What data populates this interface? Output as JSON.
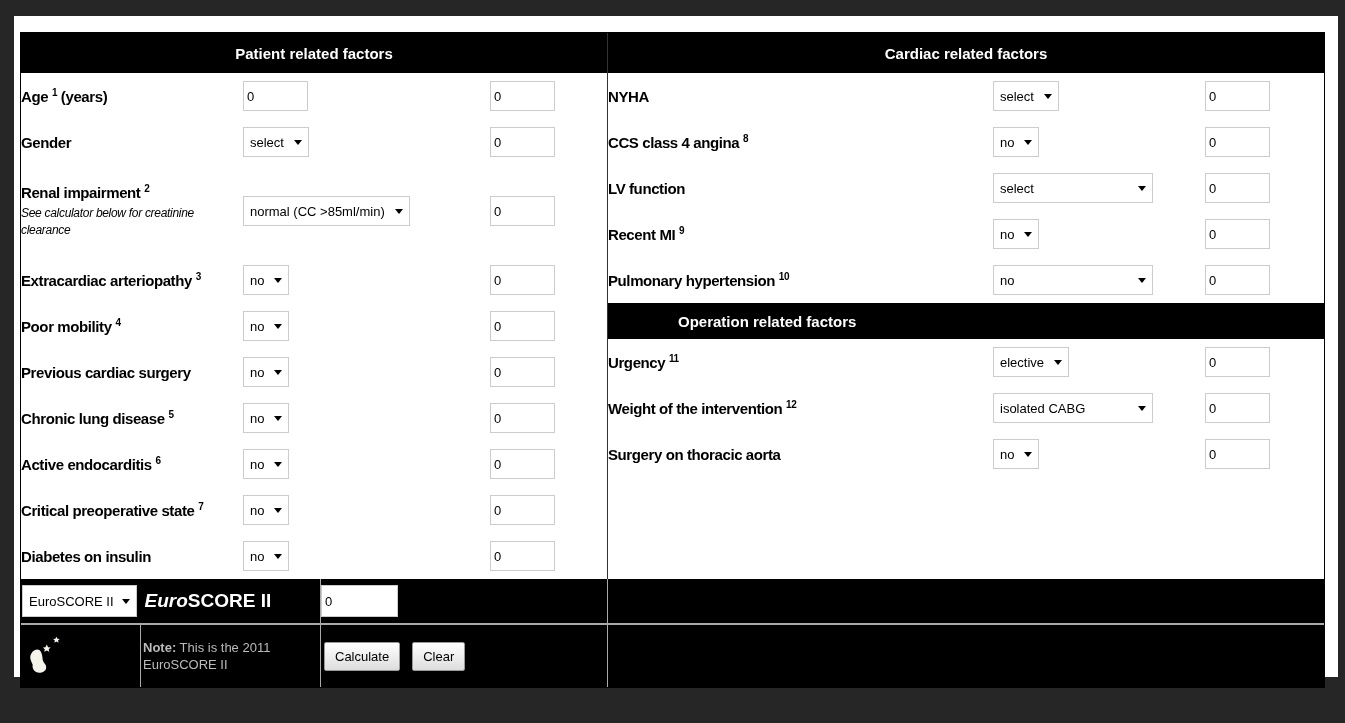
{
  "patient_factors": {
    "title": "Patient related factors",
    "rows": [
      {
        "label": "Age $^{1}$ (years)",
        "control": {
          "kind": "input",
          "value": "0"
        },
        "score": "0"
      },
      {
        "label": "Gender",
        "control": {
          "kind": "select",
          "value": "select"
        },
        "score": "0"
      },
      {
        "label": "Renal impairment $^{2}$",
        "note": "See calculator below for creatinine clearance",
        "control": {
          "kind": "select",
          "value": "normal (CC >85ml/min)"
        },
        "score": "0"
      },
      {
        "label": "Extracardiac arteriopathy $^{3}$",
        "control": {
          "kind": "select",
          "value": "no"
        },
        "score": "0"
      },
      {
        "label": "Poor mobility $^{4}$",
        "control": {
          "kind": "select",
          "value": "no"
        },
        "score": "0"
      },
      {
        "label": "Previous cardiac surgery",
        "control": {
          "kind": "select",
          "value": "no"
        },
        "score": "0"
      },
      {
        "label": "Chronic lung disease $^{5}$",
        "control": {
          "kind": "select",
          "value": "no"
        },
        "score": "0"
      },
      {
        "label": "Active endocarditis $^{6}$",
        "control": {
          "kind": "select",
          "value": "no"
        },
        "score": "0"
      },
      {
        "label": "Critical preoperative state $^{7}$",
        "control": {
          "kind": "select",
          "value": "no"
        },
        "score": "0"
      },
      {
        "label": "Diabetes on insulin",
        "control": {
          "kind": "select",
          "value": "no"
        },
        "score": "0"
      }
    ]
  },
  "cardiac_factors": {
    "title": "Cardiac related factors",
    "rows": [
      {
        "label": "NYHA",
        "control": {
          "kind": "select",
          "value": "select"
        },
        "score": "0"
      },
      {
        "label": "CCS class 4 angina $^{8}$",
        "control": {
          "kind": "select",
          "value": "no"
        },
        "score": "0"
      },
      {
        "label": "LV function",
        "control": {
          "kind": "select",
          "value": "select"
        },
        "score": "0"
      },
      {
        "label": "Recent MI $^{9}$",
        "control": {
          "kind": "select",
          "value": "no"
        },
        "score": "0"
      },
      {
        "label": "Pulmonary hypertension $^{10}$",
        "control": {
          "kind": "select",
          "value": "no"
        },
        "score": "0"
      }
    ]
  },
  "operation_factors": {
    "title": "Operation related factors",
    "rows": [
      {
        "label": "Urgency $^{11}$",
        "control": {
          "kind": "select",
          "value": "elective"
        },
        "score": "0"
      },
      {
        "label": "Weight of the intervention $^{12}$",
        "control": {
          "kind": "select",
          "value": "isolated CABG"
        },
        "score": "0"
      },
      {
        "label": "Surgery on thoracic aorta",
        "control": {
          "kind": "select",
          "value": "no"
        },
        "score": "0"
      }
    ]
  },
  "result": {
    "model_select": "EuroSCORE II",
    "title": [
      {
        "text": "Euro",
        "italic": true
      },
      {
        "text": "SCORE II",
        "italic": false
      }
    ],
    "value": "0"
  },
  "footer": {
    "note": "**Note:** This is the 2011 EuroSCORE II",
    "buttons": [
      "Calculate",
      "Clear"
    ]
  }
}
